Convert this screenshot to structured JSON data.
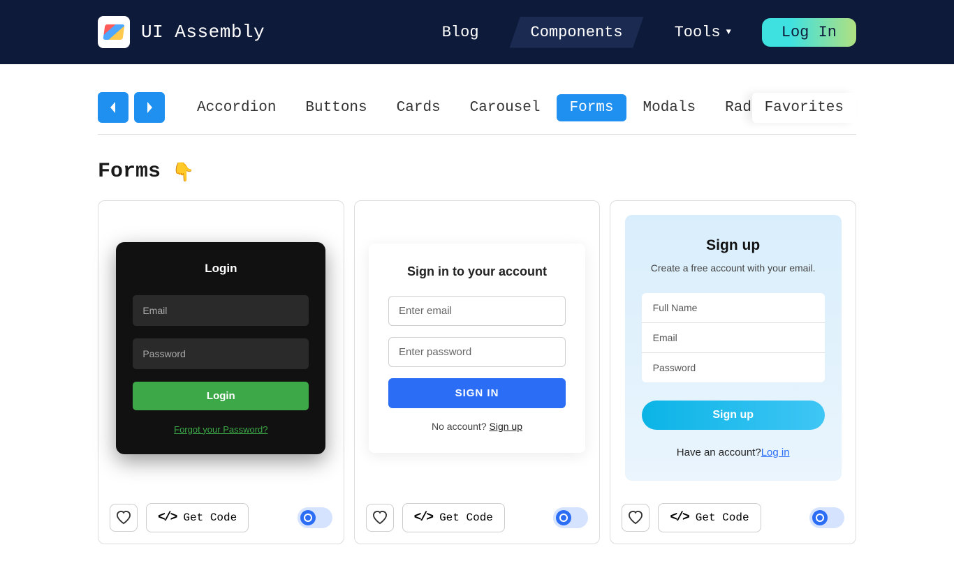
{
  "header": {
    "site_title": "UI Assembly",
    "nav": {
      "blog": "Blog",
      "components": "Components",
      "tools": "Tools"
    },
    "login_label": "Log In"
  },
  "tabs": {
    "items": [
      "Accordion",
      "Buttons",
      "Cards",
      "Carousel",
      "Forms",
      "Modals",
      "Radio Butto"
    ],
    "favorites": "Favorites",
    "active_index": 4
  },
  "page": {
    "title": "Forms"
  },
  "cards": {
    "get_code_label": "Get Code",
    "form1": {
      "title": "Login",
      "email_placeholder": "Email",
      "password_placeholder": "Password",
      "submit_label": "Login",
      "forgot_label": "Forgot your Password?"
    },
    "form2": {
      "title": "Sign in to your account",
      "email_placeholder": "Enter email",
      "password_placeholder": "Enter password",
      "submit_label": "SIGN IN",
      "footer_text": "No account? ",
      "footer_link": "Sign up"
    },
    "form3": {
      "title": "Sign up",
      "subtitle": "Create a free account with your email.",
      "name_placeholder": "Full Name",
      "email_placeholder": "Email",
      "password_placeholder": "Password",
      "submit_label": "Sign up",
      "footer_text": "Have an account?",
      "footer_link": "Log in"
    }
  }
}
